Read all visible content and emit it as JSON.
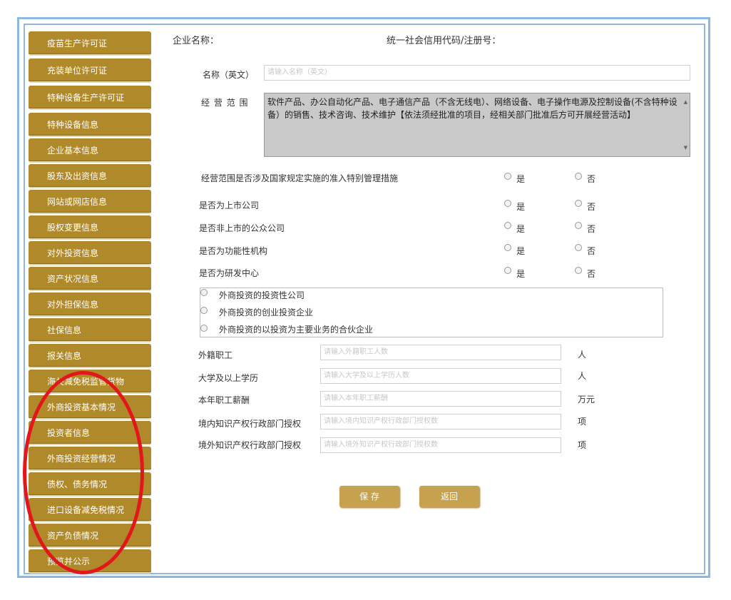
{
  "header": {
    "company_name_label": "企业名称：",
    "credit_code_label": "统一社会信用代码/注册号："
  },
  "sidebar": {
    "items": [
      "疫苗生产许可证",
      "充装单位许可证",
      "特种设备生产许可证",
      "特种设备信息",
      "企业基本信息",
      "股东及出资信息",
      "网站或网店信息",
      "股权变更信息",
      "对外投资信息",
      "资产状况信息",
      "对外担保信息",
      "社保信息",
      "报关信息",
      "海关减免税监管货物",
      "外商投资基本情况",
      "投资者信息",
      "外商投资经营情况",
      "债权、债务情况",
      "进口设备减免税情况",
      "资产负债情况",
      "预览并公示"
    ]
  },
  "form": {
    "name_en_label": "名称（英文）",
    "name_en_placeholder": "请输入名称（英文）",
    "scope_label": "经 营 范 围",
    "scope_text": "软件产品、办公自动化产品、电子通信产品（不含无线电）、网络设备、电子操作电源及控制设备(不含特种设备）的销售、技术咨询、技术维护【依法须经批准的项目，经相关部门批准后方可开展经营活动】",
    "yes": "是",
    "no": "否",
    "questions": [
      "经营范围是否涉及国家规定实施的准入特别管理措施",
      "是否为上市公司",
      "是否非上市的公众公司",
      "是否为功能性机构",
      "是否为研发中心"
    ],
    "investment_types": [
      "外商投资的投资性公司",
      "外商投资的创业投资企业",
      "外商投资的以投资为主要业务的合伙企业"
    ],
    "fields": [
      {
        "label": "外籍职工",
        "placeholder": "请输入外籍职工人数",
        "unit": "人"
      },
      {
        "label": "大学及以上学历",
        "placeholder": "请输入大学及以上学历人数",
        "unit": "人"
      },
      {
        "label": "本年职工薪酬",
        "placeholder": "请输入本年职工薪酬",
        "unit": "万元"
      },
      {
        "label": "境内知识产权行政部门授权",
        "placeholder": "请输入境内知识产权行政部门授权数",
        "unit": "项"
      },
      {
        "label": "境外知识产权行政部门授权",
        "placeholder": "请输入境外知识产权行政部门授权数",
        "unit": "项"
      }
    ]
  },
  "buttons": {
    "save": "保 存",
    "back": "返回"
  },
  "colors": {
    "sidebar_bg": "#b08a2a",
    "button_bg": "#c7a24e",
    "frame": "#8fb8de",
    "highlight": "#e2171b"
  }
}
